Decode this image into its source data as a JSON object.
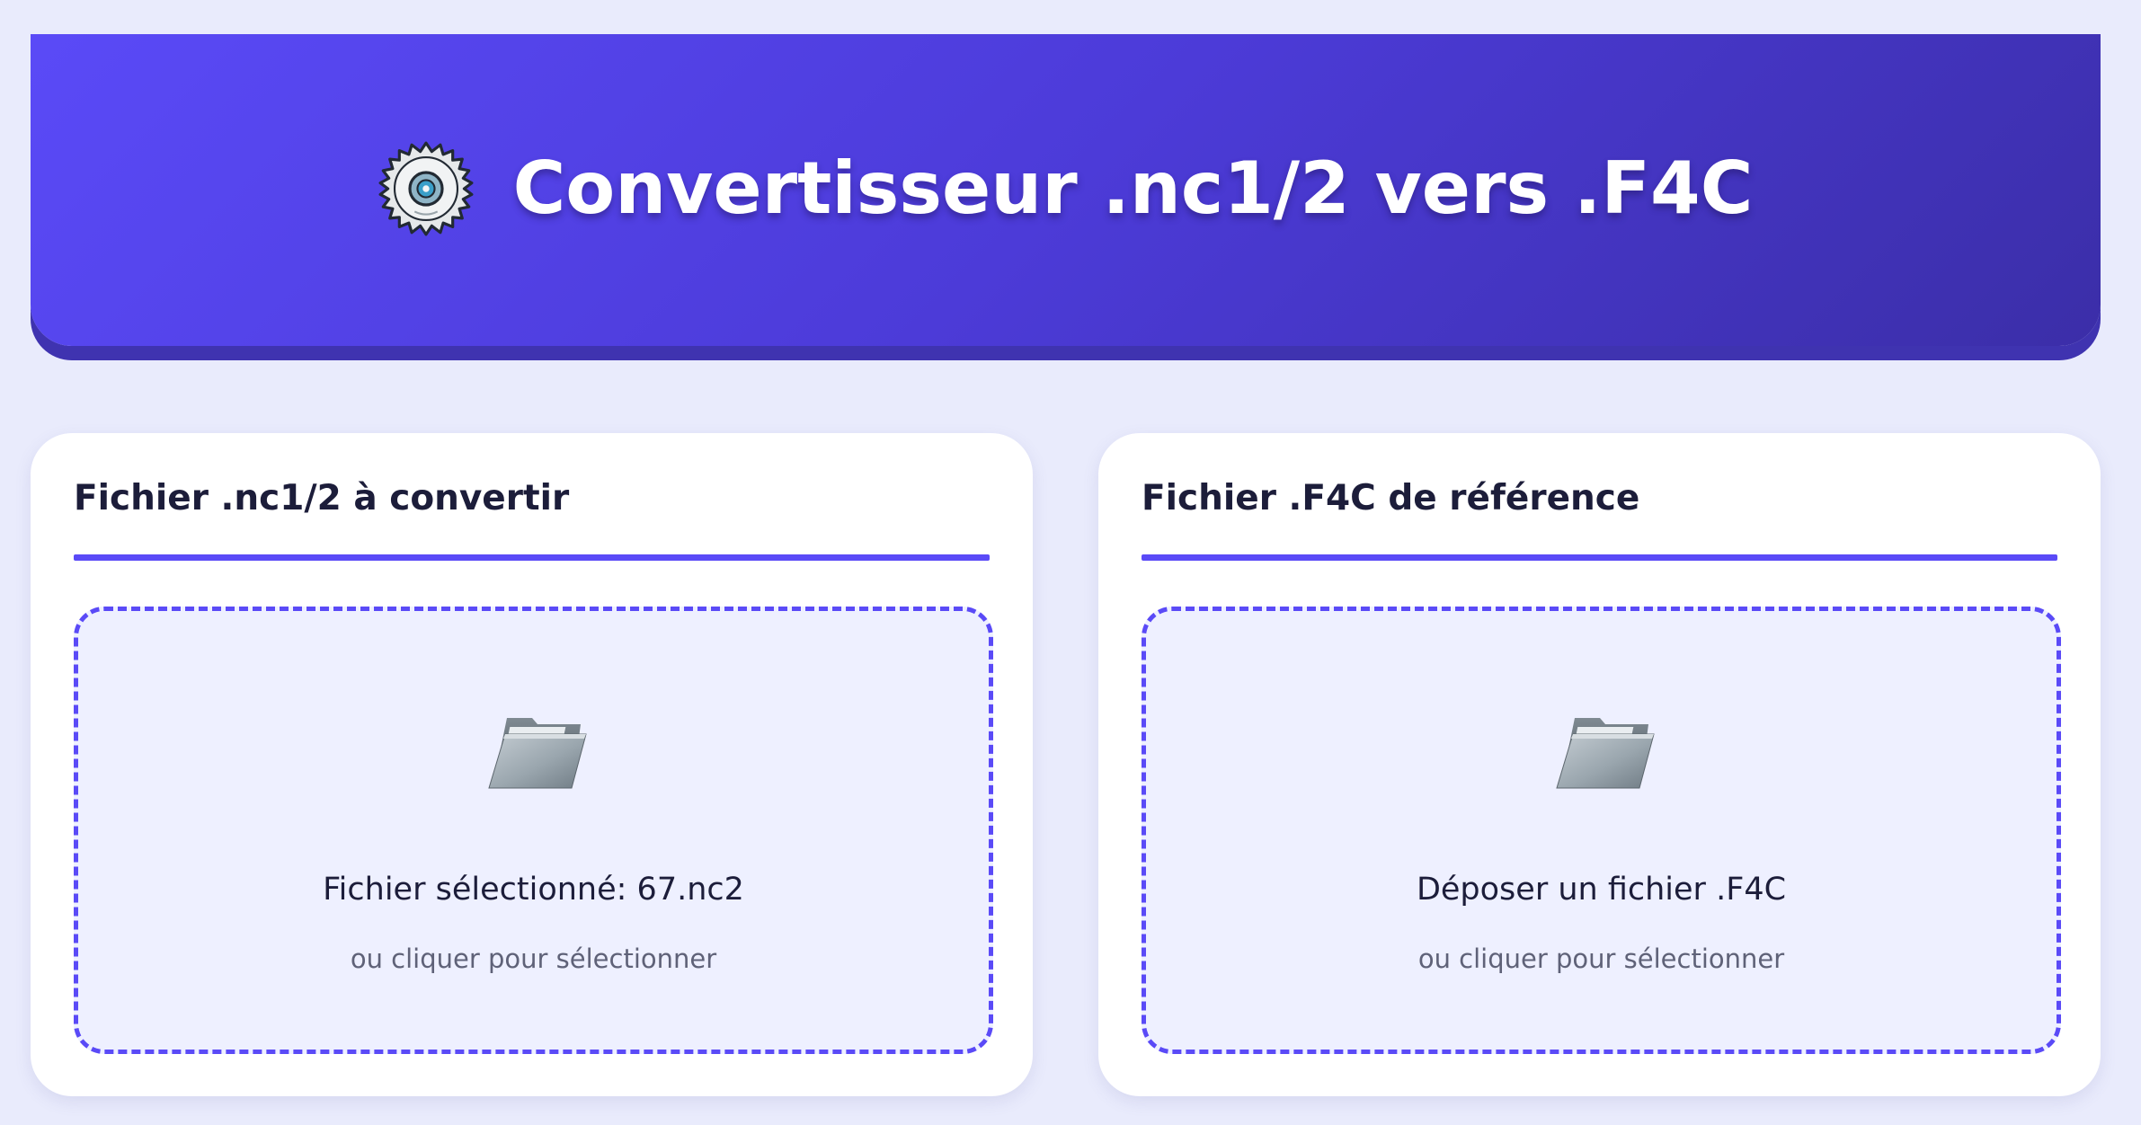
{
  "header": {
    "title": "Convertisseur .nc1/2 vers .F4C",
    "icon": "circular-saw-icon",
    "gradient_start": "#5a4af7",
    "gradient_end": "#3b2ea8"
  },
  "cards": [
    {
      "title": "Fichier .nc1/2 à convertir",
      "dropzone": {
        "icon": "folder-icon",
        "label": "Fichier sélectionné: 67.nc2",
        "hint": "ou cliquer pour sélectionner"
      }
    },
    {
      "title": "Fichier .F4C de référence",
      "dropzone": {
        "icon": "folder-icon",
        "label": "Déposer un fichier .F4C",
        "hint": "ou cliquer pour sélectionner"
      }
    }
  ],
  "colors": {
    "accent": "#5a4af7",
    "background": "#e9ebfc",
    "card": "#ffffff",
    "dropzone_bg": "#eef0ff",
    "text": "#1c1d3a",
    "muted_text": "#5f6278"
  }
}
